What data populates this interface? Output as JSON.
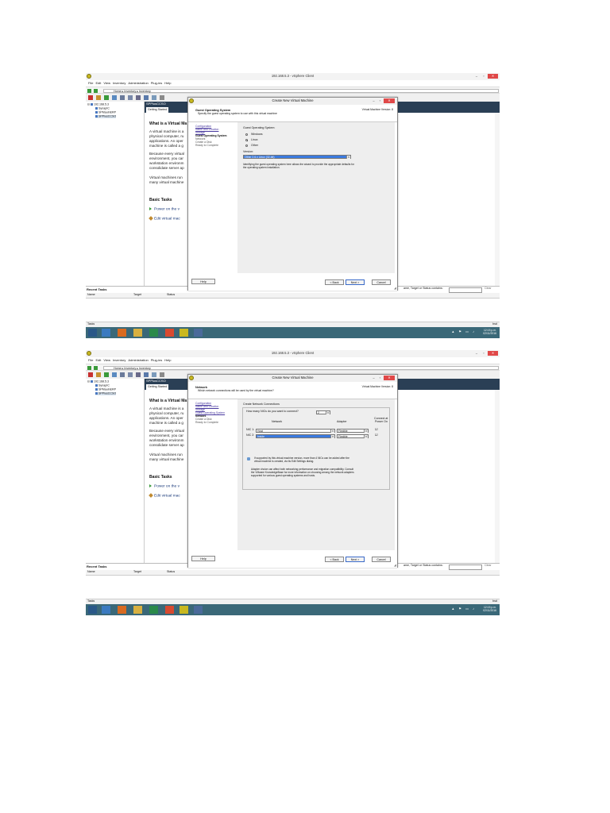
{
  "app": {
    "title": "192.168.5.3 - vSphere Client",
    "menu": [
      "File",
      "Edit",
      "View",
      "Inventory",
      "Administration",
      "Plug-ins",
      "Help"
    ],
    "breadcrumb": [
      "Home",
      "Inventory",
      "Inventory"
    ],
    "tree": [
      "192.168.5.3",
      "SynapIC",
      "SPMaulnERP",
      "SPPlusCCSO"
    ],
    "vm_name": "SPPlusCCSO",
    "tab": "Getting Started",
    "summary_title": "What is a Virtual Ma",
    "summary_para": [
      "A virtual machine is a",
      "physical computer, ru",
      "applications. An oper",
      "machine is called a g",
      "Because every virtual",
      "environment, you car",
      "workstation environm",
      "consolidate server ap",
      "Virtual machines run",
      "many virtual machine"
    ],
    "basic_tasks_title": "Basic Tasks",
    "task_power": "Power on the v",
    "task_edit": "Edit virtual mac",
    "recent_tasks": "Recent Tasks",
    "cols": [
      "Name",
      "Target",
      "Status"
    ],
    "filter_label": "ame, Target or Status contains: ",
    "clear": "Clear",
    "statusbar_left": "Tasks",
    "statusbar_right": "bsd",
    "clock_time": "12:15 p.m.",
    "clock_date": "02/11/2016"
  },
  "dialog": {
    "title": "Create New Virtual Machine",
    "version": "Virtual Machine Version: 8",
    "help": "Help",
    "back": "< Back",
    "next": "Next >",
    "cancel": "Cancel"
  },
  "step1": {
    "heading": "Guest Operating System",
    "subheading": "Specify the guest operating system to use with this virtual machine",
    "nav": [
      "Configuration",
      "Name and Location",
      "Storage",
      "Guest Operating System",
      "Network",
      "Create a Disk",
      "Ready to Complete"
    ],
    "group_label": "Guest Operating System:",
    "options": [
      "Windows",
      "Linux",
      "Other"
    ],
    "selected": "Linux",
    "version_label": "Version:",
    "version_value": "Other 2.6.x Linux (32-bit)",
    "note": "Identifying the guest operating system here allows the wizard to provide the appropriate defaults for",
    "note2": "the operating system installation."
  },
  "step2": {
    "heading": "Network",
    "subheading": "Which network connections will be used by the virtual machine?",
    "nav": [
      "Configuration",
      "Name and Location",
      "Storage",
      "Guest Operating System",
      "Network",
      "Create a Disk",
      "Ready to Complete"
    ],
    "group_label": "Create Network Connections",
    "nic_question": "How many NICs do you want to connect?",
    "nic_count": "2",
    "col_network": "Network",
    "col_adapter": "Adapter",
    "col_connect1": "Connect at",
    "col_connect2": "Power On",
    "nics": [
      {
        "label": "NIC 1:",
        "network": "Host",
        "adapter": "Flexible",
        "selected": false
      },
      {
        "label": "NIC 2:",
        "network": "Inside",
        "adapter": "Flexible",
        "selected": true
      }
    ],
    "info1": "If supported by this virtual machine version, more than 4 NICs can be added after the",
    "info1b": "virtual machine is created, via its Edit Settings dialog.",
    "info2": "Adapter choice can affect both networking performance and migration compatibility. Consult",
    "info2b": "the VMware KnowledgeBase for more information on choosing among the network adapters",
    "info2c": "supported for various guest operating systems and hosts."
  }
}
